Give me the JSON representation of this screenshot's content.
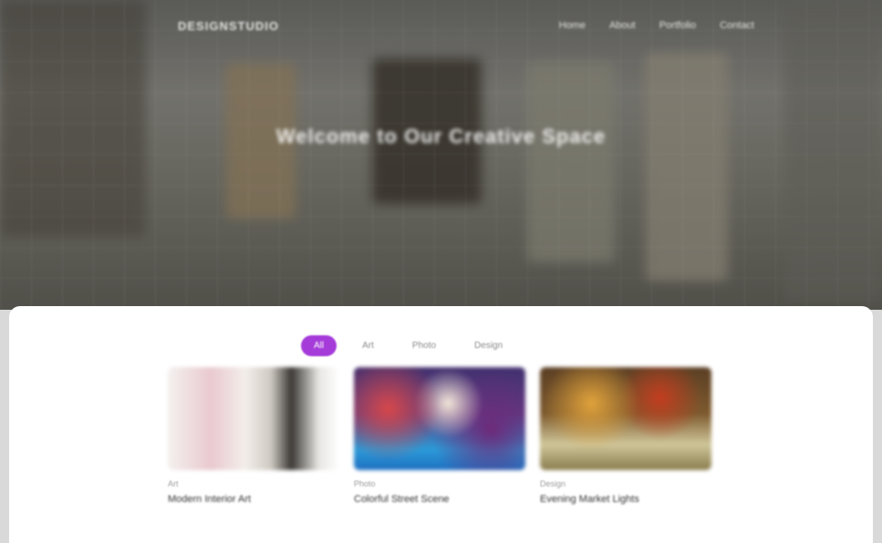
{
  "header": {
    "logo": "DESIGNSTUDIO",
    "menu": [
      "Home",
      "About",
      "Portfolio",
      "Contact"
    ]
  },
  "hero": {
    "title": "Welcome to Our Creative Space"
  },
  "portfolio": {
    "tabs": [
      {
        "label": "All",
        "active": true
      },
      {
        "label": "Art",
        "active": false
      },
      {
        "label": "Photo",
        "active": false
      },
      {
        "label": "Design",
        "active": false
      }
    ],
    "cards": [
      {
        "tag": "Art",
        "title": "Modern Interior Art"
      },
      {
        "tag": "Photo",
        "title": "Colorful Street Scene"
      },
      {
        "tag": "Design",
        "title": "Evening Market Lights"
      }
    ]
  },
  "colors": {
    "accent": "#a53bd9"
  }
}
